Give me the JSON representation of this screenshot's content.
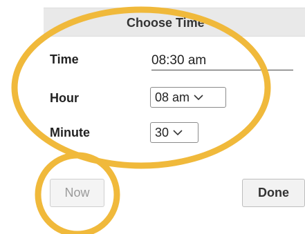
{
  "dialog": {
    "title": "Choose Time"
  },
  "fields": {
    "time_label": "Time",
    "time_value": "08:30 am",
    "hour_label": "Hour",
    "hour_value": "08 am",
    "minute_label": "Minute",
    "minute_value": "30"
  },
  "buttons": {
    "now_label": "Now",
    "done_label": "Done"
  },
  "colors": {
    "annotation": "#f0b93b",
    "header_bg": "#e9e9e9"
  },
  "icons": {
    "hour_dropdown": "chevron-down-icon",
    "minute_dropdown": "chevron-down-icon"
  }
}
